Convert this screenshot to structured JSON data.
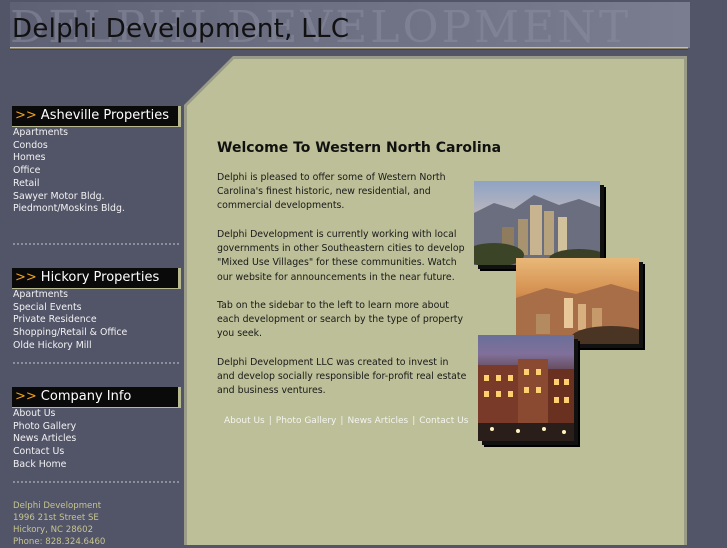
{
  "header": {
    "watermark": "DELPHI DEVELOPMENT",
    "title": "Delphi Development, LLC"
  },
  "sidebar": {
    "arrow": ">>",
    "sections": [
      {
        "heading": "Asheville Properties",
        "items": [
          "Apartments",
          "Condos",
          "Homes",
          "Office",
          "Retail",
          "Sawyer Motor Bldg.",
          "Piedmont/Moskins Bldg."
        ]
      },
      {
        "heading": "Hickory Properties",
        "items": [
          "Apartments",
          "Special Events",
          "Private Residence",
          "Shopping/Retail & Office",
          "Olde Hickory Mill"
        ]
      },
      {
        "heading": "Company Info",
        "items": [
          "About Us",
          "Photo Gallery",
          "News Articles",
          "Contact Us",
          "Back Home"
        ]
      }
    ],
    "address": [
      "Delphi Development",
      "1996 21st Street SE",
      "Hickory, NC 28602",
      "Phone: 828.324.6460"
    ]
  },
  "main": {
    "heading": "Welcome To Western North Carolina",
    "paragraphs": [
      "Delphi is pleased to offer some of Western North Carolina's finest historic, new residential, and commercial developments.",
      "Delphi Development is currently working with local governments in other Southeastern cities to develop \"Mixed Use Villages\" for these communities. Watch our website for announcements in the near future.",
      "Tab on the sidebar to the left to learn more about each development or search by the type of property you seek.",
      "Delphi Development LLC was created to invest in and develop socially responsible for-profit real estate and business ventures."
    ],
    "footer_links": [
      "About Us",
      "Photo Gallery",
      "News Articles",
      "Contact Us"
    ],
    "footer_separator": "|"
  },
  "colors": {
    "page_bg": "#525468",
    "content_bg": "#bcbf97",
    "nav_accent": "#f0a020",
    "address_text": "#c6c590"
  }
}
